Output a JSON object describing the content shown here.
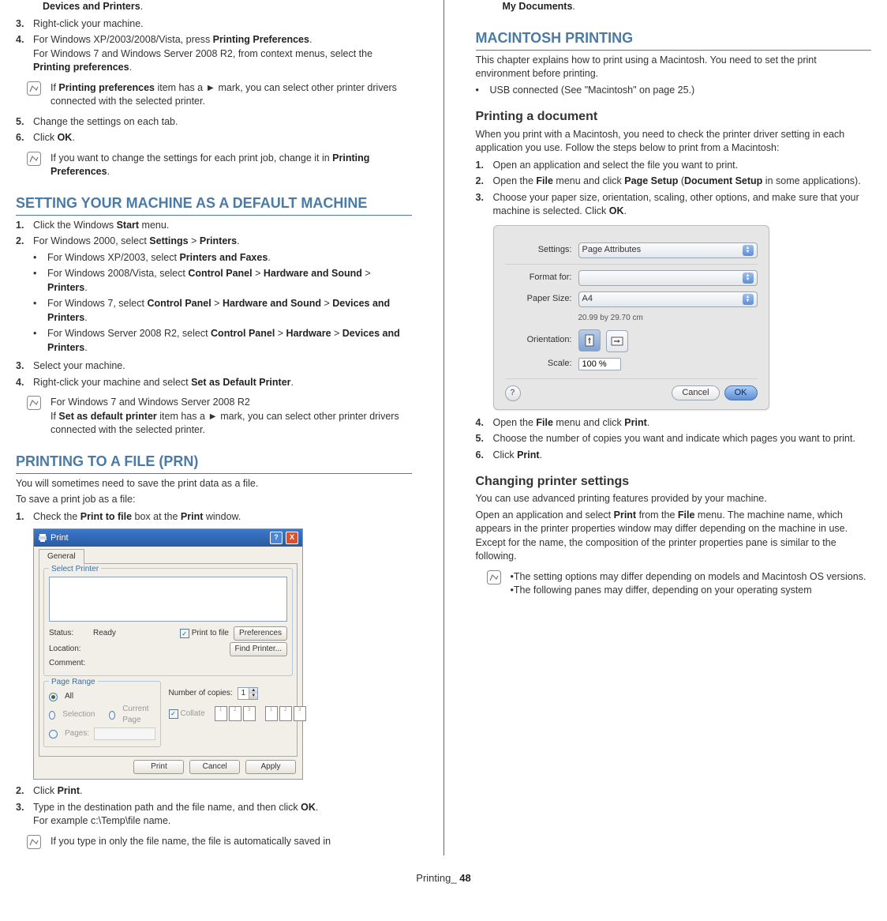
{
  "left": {
    "top_line": "Devices and Printers",
    "steps_top": [
      {
        "num": "3.",
        "body": "Right-click your machine."
      },
      {
        "num": "4.",
        "body_pre": "For Windows XP/2003/2008/Vista, press ",
        "bold1": "Printing Preferences",
        "body_post": ".",
        "line2_pre": "For Windows 7 and Windows Server 2008 R2, from context menus, select the ",
        "line2_bold": "Printing preferences",
        "line2_post": "."
      }
    ],
    "note1_pre": "If ",
    "note1_bold": "Printing preferences",
    "note1_post": " item has a ► mark, you can select other printer drivers connected with the selected printer.",
    "steps_top2": [
      {
        "num": "5.",
        "body": "Change the settings on each tab."
      },
      {
        "num": "6.",
        "body_pre": "Click ",
        "bold1": "OK",
        "body_post": "."
      }
    ],
    "note2_pre": "If you want to change the settings for each print job, change it in ",
    "note2_bold": "Printing Preferences",
    "note2_post": ".",
    "h_default": "SETTING YOUR MACHINE AS A DEFAULT MACHINE",
    "default_steps": {
      "s1_pre": "Click the Windows ",
      "s1_bold": "Start",
      "s1_post": " menu.",
      "s2_pre": "For Windows 2000, select ",
      "s2_b1": "Settings",
      "s2_mid": " > ",
      "s2_b2": "Printers",
      "s2_post": ".",
      "b1_pre": "For Windows XP/2003, select ",
      "b1_bold": "Printers and Faxes",
      "b1_post": ".",
      "b2_pre": "For Windows 2008/Vista, select ",
      "b2_b1": "Control Panel",
      "b2_m1": " > ",
      "b2_b2": "Hardware and Sound",
      "b2_m2": " > ",
      "b2_b3": "Printers",
      "b2_post": ".",
      "b3_pre": "For Windows 7, select ",
      "b3_b1": "Control Panel",
      "b3_m1": " > ",
      "b3_b2": "Hardware and Sound",
      "b3_m2": " > ",
      "b3_b3": "Devices and Printers",
      "b3_post": ".",
      "b4_pre": "For Windows Server 2008 R2, select ",
      "b4_b1": "Control Panel",
      "b4_m1": " > ",
      "b4_b2": "Hardware",
      "b4_m2": " > ",
      "b4_b3": "Devices and Printers",
      "b4_post": ".",
      "s3": "Select your machine.",
      "s4_pre": "Right-click your machine and select ",
      "s4_bold": "Set as Default Printer",
      "s4_post": "."
    },
    "note3_line1": "For Windows 7 and Windows Server 2008 R2",
    "note3_line2_pre": "If ",
    "note3_line2_bold": "Set as default printer",
    "note3_line2_post": " item has a ► mark, you can select other printer drivers connected with the selected printer.",
    "h_prn": "PRINTING TO A FILE (PRN)",
    "prn_intro1": "You will sometimes need to save the print data as a file.",
    "prn_intro2": "To save a print job as a file:",
    "prn_s1_pre": "Check the ",
    "prn_s1_b1": "Print to file",
    "prn_s1_mid": " box at the ",
    "prn_s1_b2": "Print",
    "prn_s1_post": " window.",
    "prn_s2_pre": "Click ",
    "prn_s2_bold": "Print",
    "prn_s2_post": ".",
    "prn_s3_pre": "Type in the destination path and the file name, and then click ",
    "prn_s3_bold": "OK",
    "prn_s3_post": ".",
    "prn_s3_line2": "For example c:\\Temp\\file name.",
    "note4": "If you type in only the file name, the file is automatically saved in",
    "win_dialog": {
      "title": "Print",
      "tab": "General",
      "fs1_title": "Select Printer",
      "status_label": "Status:",
      "status_value": "Ready",
      "location_label": "Location:",
      "comment_label": "Comment:",
      "print_to_file": "Print to file",
      "preferences": "Preferences",
      "find_printer": "Find Printer...",
      "fs2_title": "Page Range",
      "all": "All",
      "selection": "Selection",
      "current": "Current Page",
      "pages": "Pages:",
      "copies_label": "Number of copies:",
      "copies_value": "1",
      "collate": "Collate",
      "p1": "1",
      "p2": "2",
      "p3": "3",
      "btn_print": "Print",
      "btn_cancel": "Cancel",
      "btn_apply": "Apply"
    }
  },
  "right": {
    "top_line": "My Documents",
    "h_mac": "MACINTOSH PRINTING",
    "mac_intro": "This chapter explains how to print using a Macintosh. You need to set the print environment before printing.",
    "mac_bullet": "USB connected (See \"Macintosh\" on page 25.)",
    "h_printdoc": "Printing a document",
    "printdoc_intro": "When you print with a Macintosh, you need to check the printer driver setting in each application you use. Follow the steps below to print from a Macintosh:",
    "mac_steps": {
      "s1": "Open an application and select the file you want to print.",
      "s2_pre": "Open the ",
      "s2_b1": "File",
      "s2_m1": " menu and click ",
      "s2_b2": "Page Setup",
      "s2_m2": " (",
      "s2_b3": "Document Setup",
      "s2_post": " in some applications).",
      "s3_pre": "Choose your paper size, orientation, scaling, other options, and make sure that your machine is selected. Click ",
      "s3_bold": "OK",
      "s3_post": ".",
      "s4_pre": "Open the ",
      "s4_b1": "File",
      "s4_mid": " menu and click ",
      "s4_b2": "Print",
      "s4_post": ".",
      "s5": "Choose the number of copies you want and indicate which pages you want to print.",
      "s6_pre": "Click ",
      "s6_bold": "Print",
      "s6_post": "."
    },
    "mac_dialog": {
      "settings_label": "Settings:",
      "settings_value": "Page Attributes",
      "format_label": "Format for:",
      "paper_label": "Paper Size:",
      "paper_value": "A4",
      "paper_caption": "20.99 by 29.70 cm",
      "orient_label": "Orientation:",
      "scale_label": "Scale:",
      "scale_value": "100 %",
      "cancel": "Cancel",
      "ok": "OK"
    },
    "h_change": "Changing printer settings",
    "change_p1": "You can use advanced printing features provided by your machine.",
    "change_p2_pre": "Open an application and select ",
    "change_p2_b1": "Print",
    "change_p2_m1": " from the ",
    "change_p2_b2": "File",
    "change_p2_post": " menu. The machine name, which appears in the printer properties window may differ depending on the machine in use. Except for the name, the composition of the printer properties pane is similar to the following.",
    "note5_b1": "•The setting options may differ depending on models and Macintosh OS versions.",
    "note5_b2": "•The following panes may differ, depending on your operating system"
  },
  "footer_prefix": "Printing",
  "footer_sep": "_ ",
  "footer_page": "48"
}
